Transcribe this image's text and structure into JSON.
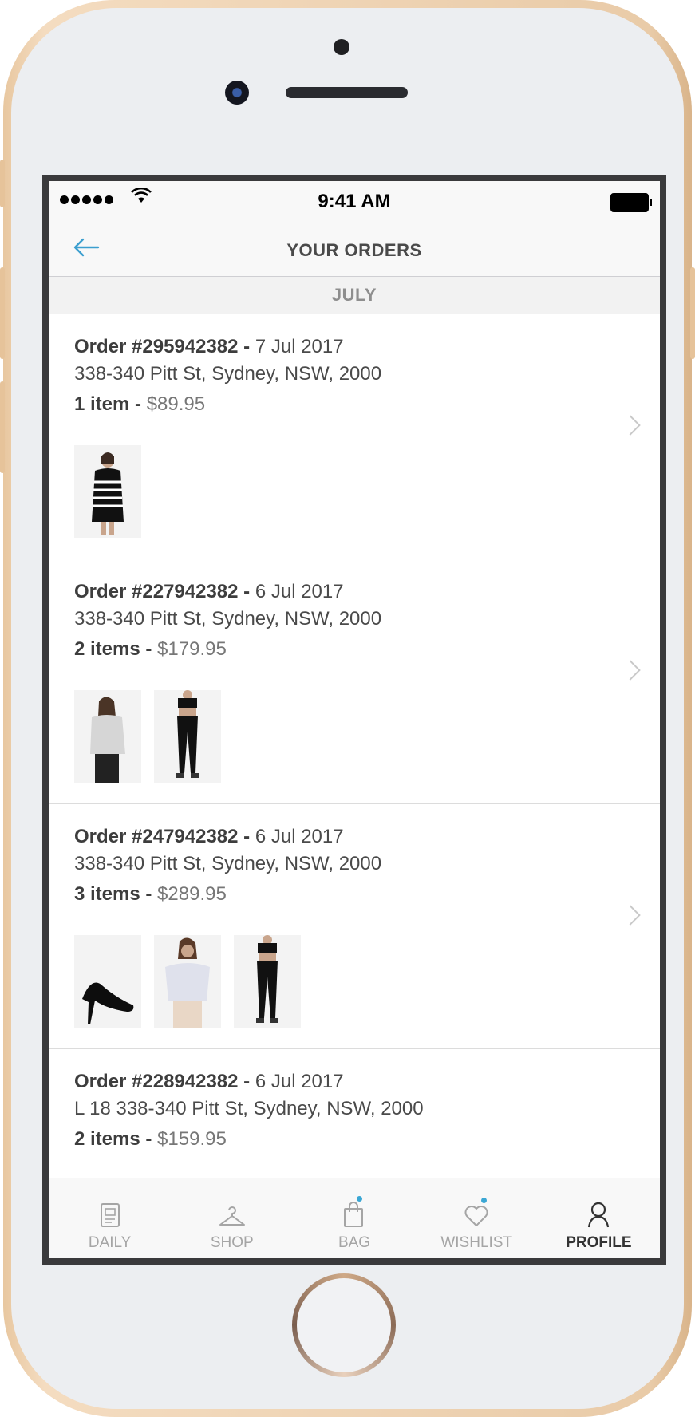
{
  "status_bar": {
    "time": "9:41 AM"
  },
  "nav": {
    "title": "YOUR ORDERS"
  },
  "section": {
    "label": "JULY"
  },
  "orders": [
    {
      "number": "Order #295942382",
      "sep": " - ",
      "date": "7 Jul 2017",
      "address": "338-340 Pitt St, Sydney, NSW, 2000",
      "count": "1 item",
      "price": "$89.95",
      "thumbs": [
        {
          "type": "dress"
        }
      ]
    },
    {
      "number": "Order #227942382",
      "sep": " - ",
      "date": "6 Jul 2017",
      "address": "338-340 Pitt St, Sydney, NSW, 2000",
      "count": "2 items",
      "price": "$179.95",
      "thumbs": [
        {
          "type": "top"
        },
        {
          "type": "leggings"
        }
      ]
    },
    {
      "number": "Order #247942382",
      "sep": " - ",
      "date": "6 Jul 2017",
      "address": "338-340 Pitt St, Sydney, NSW, 2000",
      "count": "3 items",
      "price": "$289.95",
      "thumbs": [
        {
          "type": "heels"
        },
        {
          "type": "blouse"
        },
        {
          "type": "leggings"
        }
      ]
    },
    {
      "number": "Order #228942382",
      "sep": " - ",
      "date": "6 Jul 2017",
      "address": "L 18 338-340 Pitt St, Sydney, NSW, 2000",
      "count": "2 items",
      "price": "$159.95",
      "thumbs": []
    }
  ],
  "tabs": [
    {
      "label": "DAILY",
      "icon": "daily-icon",
      "active": false
    },
    {
      "label": "SHOP",
      "icon": "hanger-icon",
      "active": false
    },
    {
      "label": "BAG",
      "icon": "bag-icon",
      "active": false
    },
    {
      "label": "WISHLIST",
      "icon": "heart-icon",
      "active": false
    },
    {
      "label": "PROFILE",
      "icon": "profile-icon",
      "active": true
    }
  ],
  "colors": {
    "accent": "#3c9fcf"
  }
}
